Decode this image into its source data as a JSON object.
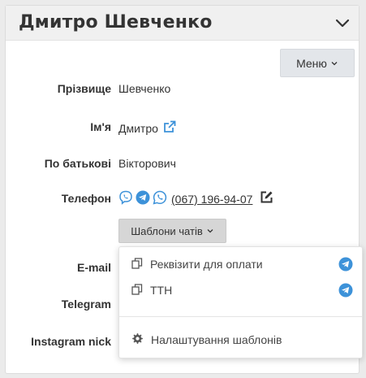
{
  "header": {
    "title": "Дмитро Шевченко"
  },
  "toolbar": {
    "menu_label": "Меню"
  },
  "fields": {
    "surname": {
      "label": "Прізвище",
      "value": "Шевченко"
    },
    "first_name": {
      "label": "Ім'я",
      "value": "Дмитро"
    },
    "patronymic": {
      "label": "По батькові",
      "value": "Вікторович"
    },
    "phone": {
      "label": "Телефон",
      "value": "(067) 196-94-07"
    },
    "email": {
      "label": "E-mail"
    },
    "telegram": {
      "label": "Telegram"
    },
    "instagram": {
      "label": "Instagram nick"
    }
  },
  "templates": {
    "button_label": "Шаблони чатів",
    "items": [
      {
        "label": "Реквізити для оплати",
        "channel": "telegram-icon"
      },
      {
        "label": "ТТН",
        "channel": "telegram-icon"
      }
    ],
    "settings_label": "Налаштування шаблонів"
  },
  "colors": {
    "accent": "#3d92d9",
    "viber": "#3d92d9",
    "whatsapp": "#3d92d9"
  }
}
